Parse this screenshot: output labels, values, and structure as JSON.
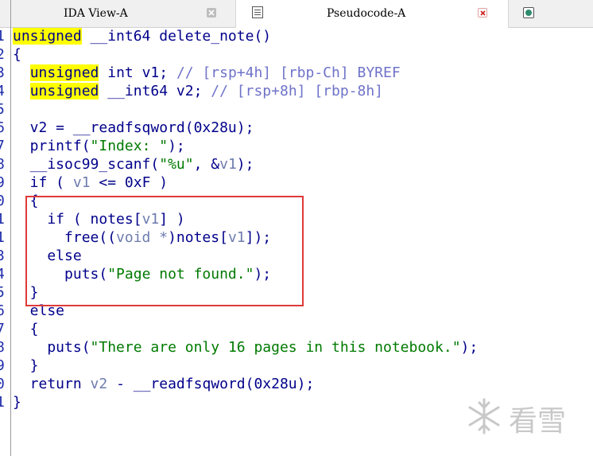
{
  "tabs": [
    {
      "label": "IDA View-A",
      "active": false
    },
    {
      "label": "Pseudocode-A",
      "active": true
    },
    {
      "label": "",
      "icon": "hex-view-icon"
    }
  ],
  "code_lines": [
    {
      "num": "1",
      "parts": [
        [
          "kwhl",
          "unsigned"
        ],
        [
          "t",
          " __int64 delete_note()"
        ]
      ]
    },
    {
      "num": "2",
      "parts": [
        [
          "t",
          "{"
        ]
      ]
    },
    {
      "num": "3",
      "parts": [
        [
          "t",
          "  "
        ],
        [
          "kwhl",
          "unsigned"
        ],
        [
          "t",
          " int v1; "
        ],
        [
          "cm",
          "// [rsp+4h] [rbp-Ch] BYREF"
        ]
      ]
    },
    {
      "num": "4",
      "parts": [
        [
          "t",
          "  "
        ],
        [
          "kwhl",
          "unsigned"
        ],
        [
          "t",
          " __int64 v2; "
        ],
        [
          "cm",
          "// [rsp+8h] [rbp-8h]"
        ]
      ]
    },
    {
      "num": "5",
      "parts": [
        [
          "t",
          ""
        ]
      ]
    },
    {
      "num": "6",
      "parts": [
        [
          "t",
          "  v2 = __readfsqword(0x28u);"
        ]
      ]
    },
    {
      "num": "7",
      "parts": [
        [
          "t",
          "  printf("
        ],
        [
          "st",
          "\"Index: \""
        ],
        [
          "t",
          ");"
        ]
      ]
    },
    {
      "num": "8",
      "parts": [
        [
          "t",
          "  __isoc99_scanf("
        ],
        [
          "st",
          "\"%u\""
        ],
        [
          "t",
          ", &"
        ],
        [
          "var",
          "v1"
        ],
        [
          "t",
          ");"
        ]
      ]
    },
    {
      "num": "9",
      "parts": [
        [
          "t",
          "  if ( "
        ],
        [
          "var",
          "v1"
        ],
        [
          "t",
          " <= 0xF )"
        ]
      ]
    },
    {
      "num": "0",
      "parts": [
        [
          "t",
          "  {"
        ]
      ]
    },
    {
      "num": "1",
      "parts": [
        [
          "t",
          "    if ( notes["
        ],
        [
          "var",
          "v1"
        ],
        [
          "t",
          "] )"
        ]
      ]
    },
    {
      "num": "1",
      "parts": [
        [
          "t",
          "      free(("
        ],
        [
          "var",
          "void *"
        ],
        [
          "t",
          ")notes["
        ],
        [
          "var",
          "v1"
        ],
        [
          "t",
          "]);"
        ]
      ]
    },
    {
      "num": "3",
      "parts": [
        [
          "t",
          "    else"
        ]
      ]
    },
    {
      "num": "4",
      "parts": [
        [
          "t",
          "      puts("
        ],
        [
          "st",
          "\"Page not found.\""
        ],
        [
          "t",
          ");"
        ]
      ]
    },
    {
      "num": "5",
      "parts": [
        [
          "t",
          "  }"
        ]
      ]
    },
    {
      "num": "6",
      "parts": [
        [
          "t",
          "  else"
        ]
      ]
    },
    {
      "num": "7",
      "parts": [
        [
          "t",
          "  {"
        ]
      ]
    },
    {
      "num": "8",
      "parts": [
        [
          "t",
          "    puts("
        ],
        [
          "st",
          "\"There are only 16 pages in this notebook.\""
        ],
        [
          "t",
          ");"
        ]
      ]
    },
    {
      "num": "9",
      "parts": [
        [
          "t",
          "  }"
        ]
      ]
    },
    {
      "num": "0",
      "parts": [
        [
          "t",
          "  return "
        ],
        [
          "var",
          "v2"
        ],
        [
          "t",
          " - __readfsqword(0x28u);"
        ]
      ]
    },
    {
      "num": "1",
      "parts": [
        [
          "t",
          "}"
        ]
      ]
    }
  ],
  "watermark": {
    "text": "看雪"
  },
  "colors": {
    "highlight": "#ffff00",
    "annotation_box": "#e03a3a",
    "code": "#00008b",
    "string": "#007a00",
    "comment": "#6f73c8",
    "variable": "#6e7cae"
  }
}
